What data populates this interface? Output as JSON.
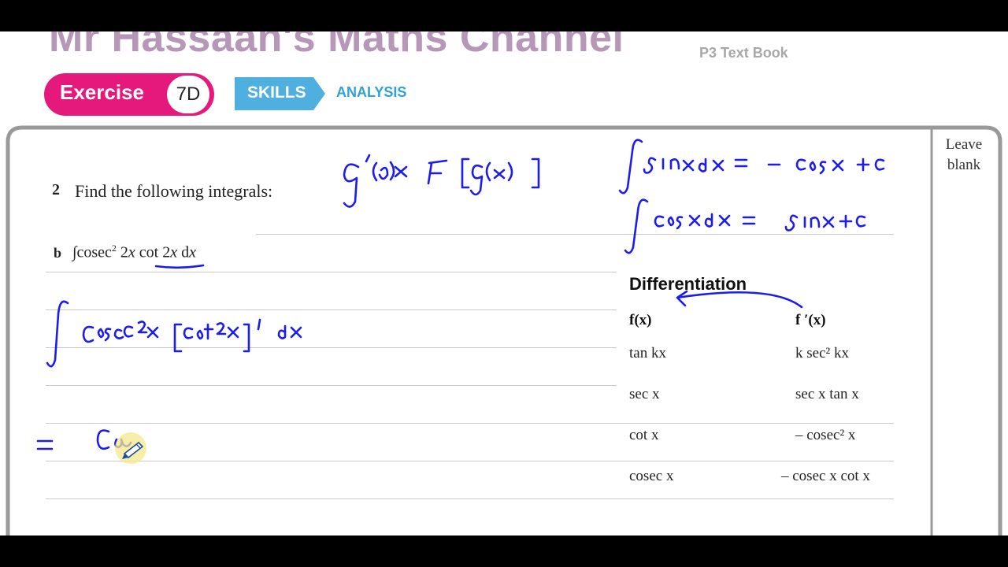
{
  "header": {
    "channel_title": "Mr Hassaan's Maths Channel",
    "book_label": "P3 Text Book",
    "exercise_label": "Exercise",
    "exercise_number": "7D",
    "skills_label": "SKILLS",
    "analysis_label": "ANALYSIS"
  },
  "margin": {
    "leave_line1": "Leave",
    "leave_line2": "blank"
  },
  "question": {
    "number": "2",
    "text": "Find the following integrals:",
    "part_label": "b",
    "part_integral_sign": "∫",
    "part_expr_a": "cosec",
    "part_expr_sup": "2",
    "part_expr_b": " 2",
    "part_expr_x1": "x",
    "part_expr_c": " cot 2",
    "part_expr_x2": "x",
    "part_expr_d": " d",
    "part_expr_x3": "x"
  },
  "differentiation": {
    "title": "Differentiation",
    "col_fx": "f(x)",
    "col_fpx": "f ′(x)",
    "rows": [
      {
        "fx": "tan kx",
        "fpx": "k sec² kx"
      },
      {
        "fx": "sec x",
        "fpx": "sec x tan x"
      },
      {
        "fx": "cot x",
        "fpx": "– cosec² x"
      },
      {
        "fx": "cosec x",
        "fpx": "– cosec x cot x"
      }
    ]
  },
  "colors": {
    "brand_pink": "#e5197c",
    "skills_blue": "#4fb0df",
    "analysis_blue": "#2fa2d8",
    "title_mauve": "#b797b7",
    "ink_blue": "#1c1cf0",
    "highlight": "#f5e88a"
  },
  "icons": {
    "pen_cursor": "pen-cursor-icon"
  }
}
